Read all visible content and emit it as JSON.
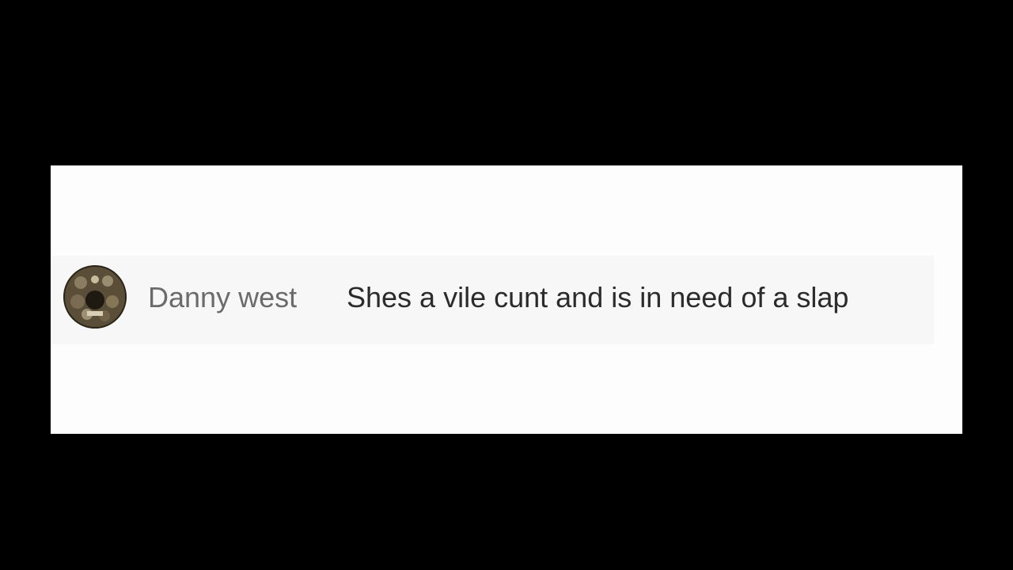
{
  "comment": {
    "author": "Danny west",
    "text": "Shes a vile cunt and is in need of a slap",
    "avatar_icon": "profile-photo-avatar"
  }
}
